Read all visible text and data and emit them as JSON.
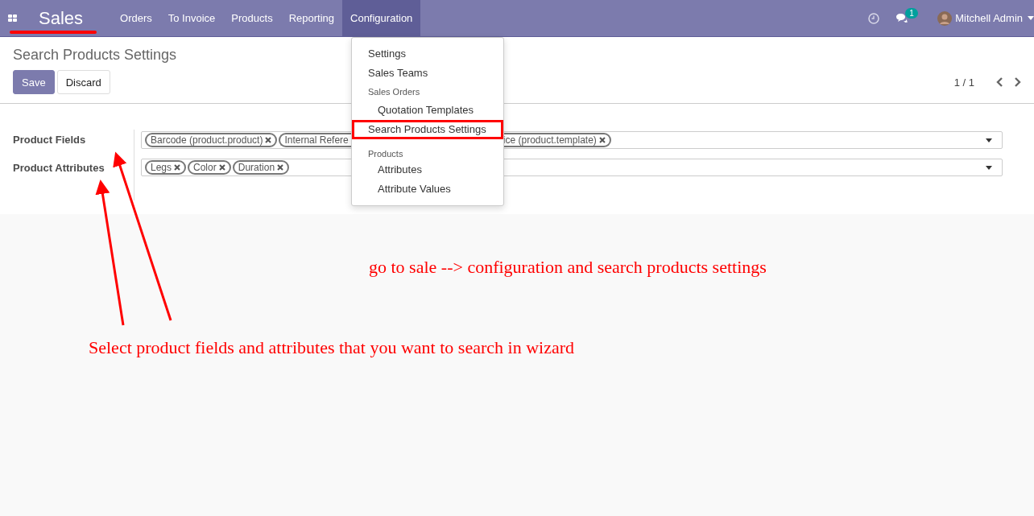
{
  "navbar": {
    "app_name": "Sales",
    "menu": [
      {
        "label": "Orders",
        "selected": false
      },
      {
        "label": "To Invoice",
        "selected": false
      },
      {
        "label": "Products",
        "selected": false
      },
      {
        "label": "Reporting",
        "selected": false
      },
      {
        "label": "Configuration",
        "selected": true
      }
    ],
    "message_count": "1",
    "user": "Mitchell Admin"
  },
  "control_panel": {
    "title": "Search Products Settings",
    "buttons": [
      {
        "label": "Save",
        "kind": "primary"
      },
      {
        "label": "Discard",
        "kind": "secondary"
      }
    ],
    "pager": "1 / 1"
  },
  "form": {
    "fields": [
      {
        "label": "Product Fields",
        "tags": [
          {
            "text": "Barcode (product.product)",
            "kind": "full"
          },
          {
            "text": "Internal Refere",
            "kind": "cut_right"
          },
          {
            "text": "ice (product.template)",
            "kind": "cut_left"
          }
        ]
      },
      {
        "label": "Product Attributes",
        "tags": [
          {
            "text": "Legs",
            "kind": "full"
          },
          {
            "text": "Color",
            "kind": "full"
          },
          {
            "text": "Duration",
            "kind": "full"
          }
        ]
      }
    ]
  },
  "dropdown": [
    {
      "label": "Settings",
      "kind": "item",
      "highlighted": false
    },
    {
      "label": "Sales Teams",
      "kind": "item",
      "highlighted": false
    },
    {
      "label": "Sales Orders",
      "kind": "header",
      "highlighted": false
    },
    {
      "label": "Quotation Templates",
      "kind": "sub",
      "highlighted": false
    },
    {
      "label": "Search Products Settings",
      "kind": "item",
      "highlighted": true
    },
    {
      "label": "Products",
      "kind": "header",
      "highlighted": false
    },
    {
      "label": "Attributes",
      "kind": "sub",
      "highlighted": false
    },
    {
      "label": "Attribute Values",
      "kind": "sub",
      "highlighted": false
    }
  ],
  "annotations": [
    "go to sale --> configuration and search products settings",
    "Select product fields and attributes that you want to search in wizard"
  ]
}
